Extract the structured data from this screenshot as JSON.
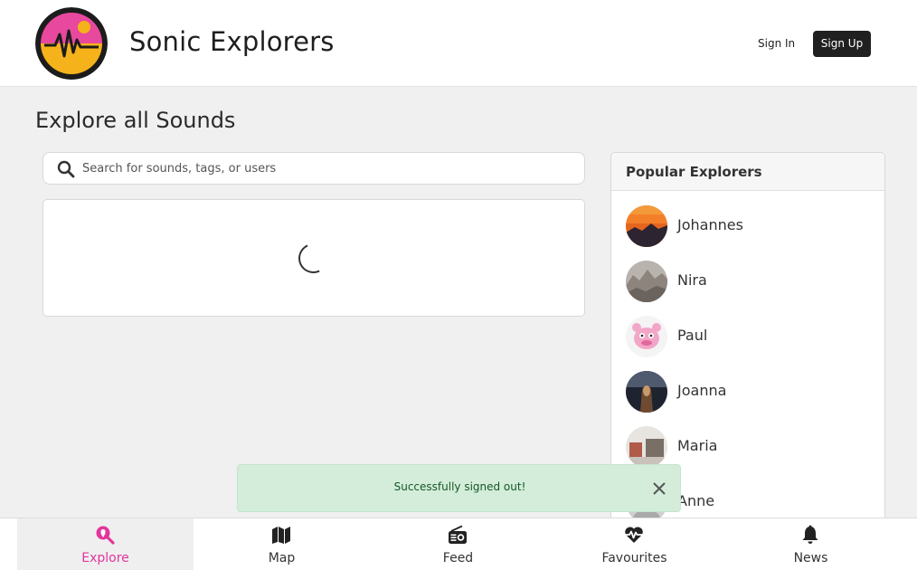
{
  "header": {
    "brand": "Sonic Explorers",
    "sign_in": "Sign In",
    "sign_up": "Sign Up",
    "logo_icon": "sound-wave-logo-icon"
  },
  "page": {
    "title": "Explore all Sounds"
  },
  "search": {
    "placeholder": "Search for sounds, tags, or users",
    "value": "",
    "icon": "search-icon"
  },
  "results": {
    "state": "loading"
  },
  "popular": {
    "title": "Popular Explorers",
    "explorers": [
      {
        "name": "Johannes"
      },
      {
        "name": "Nira"
      },
      {
        "name": "Paul"
      },
      {
        "name": "Joanna"
      },
      {
        "name": "Maria"
      },
      {
        "name": "Anne"
      }
    ]
  },
  "toast": {
    "message": "Successfully signed out!"
  },
  "tabs": [
    {
      "label": "Explore",
      "icon": "search-location-icon",
      "active": true
    },
    {
      "label": "Map",
      "icon": "map-icon",
      "active": false
    },
    {
      "label": "Feed",
      "icon": "radio-icon",
      "active": false
    },
    {
      "label": "Favourites",
      "icon": "heartbeat-icon",
      "active": false
    },
    {
      "label": "News",
      "icon": "bell-icon",
      "active": false
    }
  ],
  "colors": {
    "accent": "#e2369c",
    "toast_bg": "#d4edda",
    "toast_text": "#155724",
    "button_dark": "#202020"
  }
}
